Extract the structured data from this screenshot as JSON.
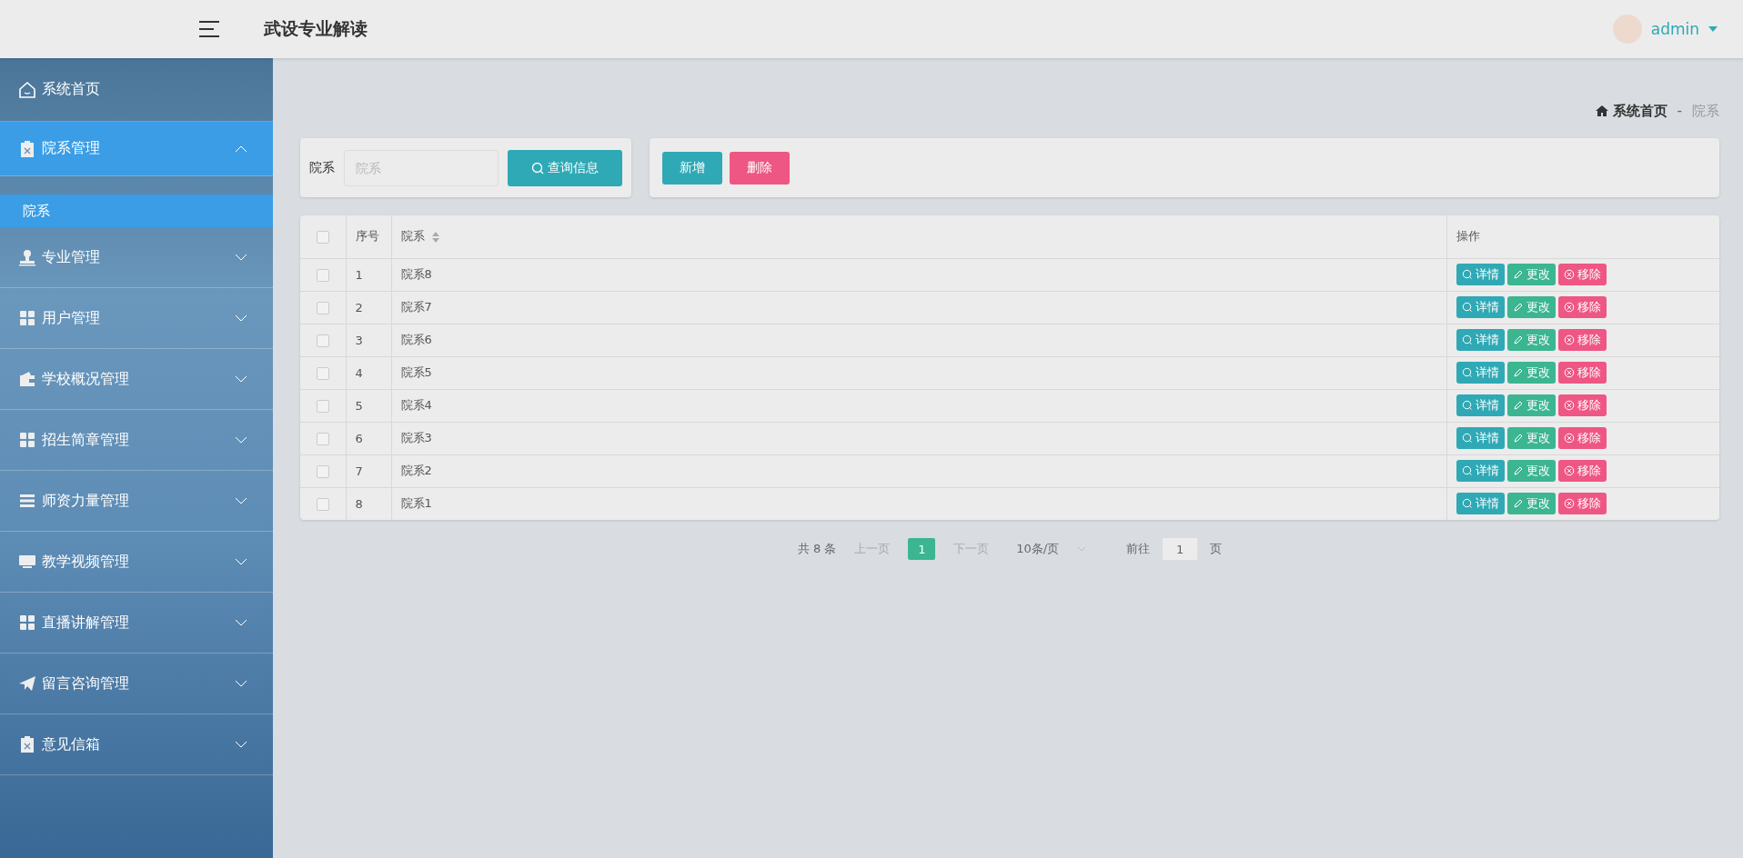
{
  "header": {
    "title": "武设专业解读",
    "user": "admin"
  },
  "sidebar": {
    "items": [
      {
        "label": "系统首页",
        "selected": false
      },
      {
        "label": "院系管理",
        "expanded": true,
        "selected": true,
        "children": [
          {
            "label": "院系",
            "selected": true
          }
        ]
      },
      {
        "label": "专业管理",
        "expanded": false,
        "selected": false
      },
      {
        "label": "用户管理",
        "expanded": false,
        "selected": false
      },
      {
        "label": "学校概况管理",
        "expanded": false,
        "selected": false
      },
      {
        "label": "招生简章管理",
        "expanded": false,
        "selected": false
      },
      {
        "label": "师资力量管理",
        "expanded": false,
        "selected": false
      },
      {
        "label": "教学视频管理",
        "expanded": false,
        "selected": false
      },
      {
        "label": "直播讲解管理",
        "expanded": false,
        "selected": false
      },
      {
        "label": "留言咨询管理",
        "expanded": false,
        "selected": false
      },
      {
        "label": "意见信箱",
        "expanded": false,
        "selected": false
      }
    ]
  },
  "breadcrumb": {
    "home": "系统首页",
    "separator": "-",
    "current": "院系"
  },
  "search": {
    "label": "院系",
    "placeholder": "院系",
    "button": "查询信息"
  },
  "actions": [
    {
      "kind": "primary",
      "label": "新增"
    },
    {
      "kind": "danger",
      "label": "删除"
    }
  ],
  "table": {
    "columns": [
      {
        "label": "序号"
      },
      {
        "label": "院系"
      },
      {
        "label": "操作"
      }
    ],
    "all_checked": false,
    "rows": [
      {
        "no": "1",
        "name": "院系8",
        "checked": false,
        "actions": [
          {
            "kind": "detail",
            "label": "详情"
          },
          {
            "kind": "edit",
            "label": "更改"
          },
          {
            "kind": "remove",
            "label": "移除"
          }
        ]
      },
      {
        "no": "2",
        "name": "院系7",
        "checked": false,
        "actions": [
          {
            "kind": "detail",
            "label": "详情"
          },
          {
            "kind": "edit",
            "label": "更改"
          },
          {
            "kind": "remove",
            "label": "移除"
          }
        ]
      },
      {
        "no": "3",
        "name": "院系6",
        "checked": false,
        "actions": [
          {
            "kind": "detail",
            "label": "详情"
          },
          {
            "kind": "edit",
            "label": "更改"
          },
          {
            "kind": "remove",
            "label": "移除"
          }
        ]
      },
      {
        "no": "4",
        "name": "院系5",
        "checked": false,
        "actions": [
          {
            "kind": "detail",
            "label": "详情"
          },
          {
            "kind": "edit",
            "label": "更改"
          },
          {
            "kind": "remove",
            "label": "移除"
          }
        ]
      },
      {
        "no": "5",
        "name": "院系4",
        "checked": false,
        "actions": [
          {
            "kind": "detail",
            "label": "详情"
          },
          {
            "kind": "edit",
            "label": "更改"
          },
          {
            "kind": "remove",
            "label": "移除"
          }
        ]
      },
      {
        "no": "6",
        "name": "院系3",
        "checked": false,
        "actions": [
          {
            "kind": "detail",
            "label": "详情"
          },
          {
            "kind": "edit",
            "label": "更改"
          },
          {
            "kind": "remove",
            "label": "移除"
          }
        ]
      },
      {
        "no": "7",
        "name": "院系2",
        "checked": false,
        "actions": [
          {
            "kind": "detail",
            "label": "详情"
          },
          {
            "kind": "edit",
            "label": "更改"
          },
          {
            "kind": "remove",
            "label": "移除"
          }
        ]
      },
      {
        "no": "8",
        "name": "院系1",
        "checked": false,
        "actions": [
          {
            "kind": "detail",
            "label": "详情"
          },
          {
            "kind": "edit",
            "label": "更改"
          },
          {
            "kind": "remove",
            "label": "移除"
          }
        ]
      }
    ]
  },
  "pagination": {
    "total": "共 8 条",
    "prev": "上一页",
    "pages": [
      {
        "label": "1",
        "selected": true
      }
    ],
    "next": "下一页",
    "page_size": "10条/页",
    "goto_label": "前往",
    "goto_value": "1",
    "goto_suffix": "页"
  }
}
